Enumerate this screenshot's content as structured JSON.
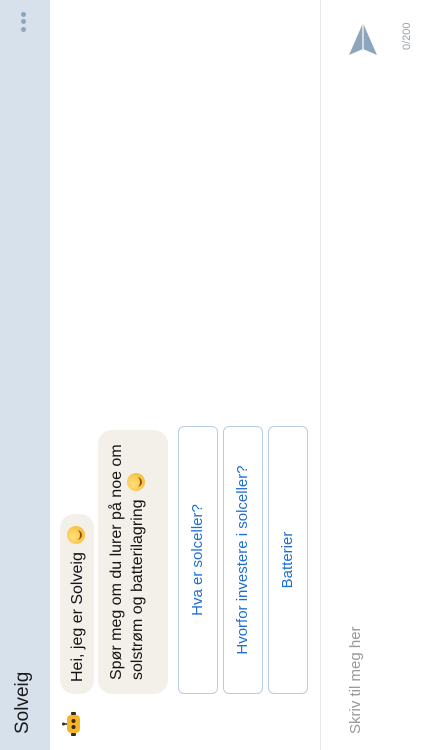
{
  "header": {
    "title": "Solveig",
    "menu_icon": "more-dots-icon"
  },
  "messages": [
    {
      "text": "Hei, jeg er Solveig",
      "emoji": "smiling-face"
    },
    {
      "text": "Spør meg om du lurer på noe om solstrøm og batterilagring",
      "emoji": "smiling-face"
    }
  ],
  "quick_replies": [
    {
      "label": "Hva er solceller?"
    },
    {
      "label": "Hvorfor investere i solceller?"
    },
    {
      "label": "Batterier"
    }
  ],
  "input": {
    "placeholder": "Skriv til meg her",
    "value": "",
    "counter": "0/200"
  },
  "colors": {
    "header_bg": "#d6e1eb",
    "link": "#1f6fd2",
    "bubble_bg": "#f3efe9",
    "send_icon": "#8ea6bd"
  }
}
